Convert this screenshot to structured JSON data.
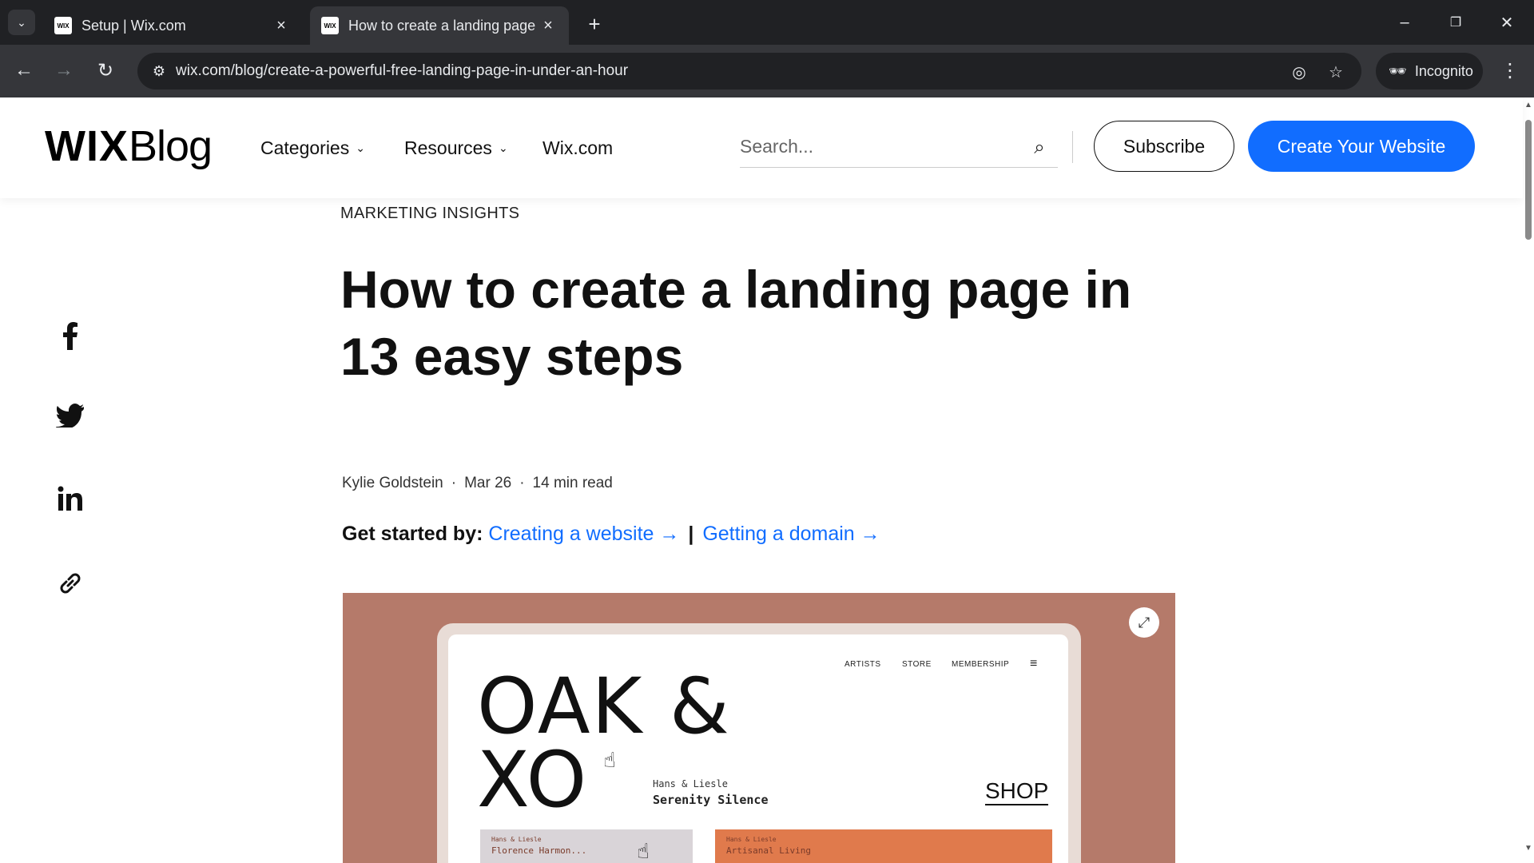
{
  "browser": {
    "tabs": [
      {
        "title": "Setup | Wix.com",
        "favicon": "WIX"
      },
      {
        "title": "How to create a landing page in 13 easy steps",
        "favicon": "WIX"
      }
    ],
    "url": "wix.com/blog/create-a-powerful-free-landing-page-in-under-an-hour",
    "incognito_label": "Incognito"
  },
  "header": {
    "logo_wix": "WIX",
    "logo_blog": "Blog",
    "nav": {
      "categories": "Categories",
      "resources": "Resources",
      "wixcom": "Wix.com"
    },
    "search_placeholder": "Search...",
    "subscribe": "Subscribe",
    "create": "Create Your Website",
    "accent_color": "#116dff"
  },
  "article": {
    "category": "MARKETING INSIGHTS",
    "title": "How to create a landing page in 13 easy steps",
    "author": "Kylie Goldstein",
    "date": "Mar 26",
    "read_time": "14 min read",
    "get_started_label": "Get started by:",
    "link1": "Creating a website →",
    "link2": "Getting a domain →"
  },
  "hero": {
    "nav": [
      "ARTISTS",
      "STORE",
      "MEMBERSHIP"
    ],
    "title_line1": "OAK &",
    "title_line2": "XO",
    "sub1": "Hans & Liesle",
    "sub2": "Serenity Silence",
    "shop": "SHOP",
    "card1_small": "Hans & Liesle",
    "card1_big": "Florence Harmon...",
    "card2_small": "Hans & Liesle",
    "card2_big": "Artisanal Living",
    "bg_color": "#b57a6a"
  }
}
